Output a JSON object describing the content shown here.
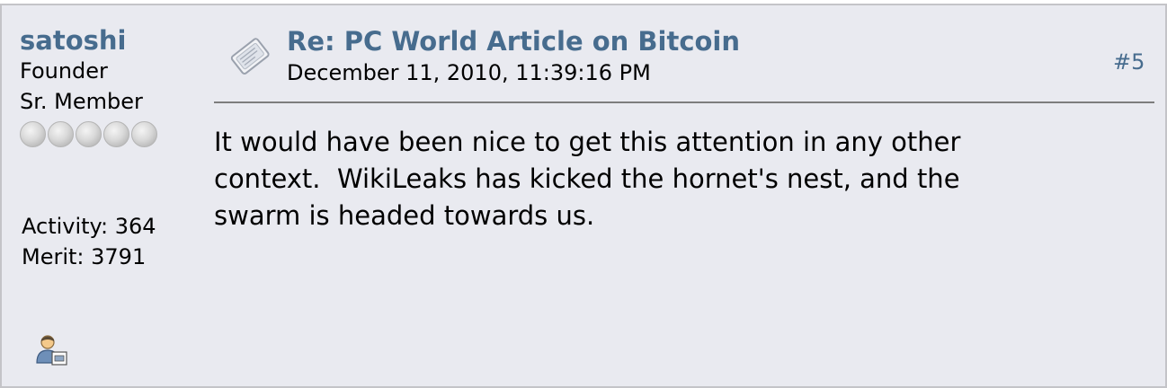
{
  "poster": {
    "name": "satoshi",
    "title": "Founder",
    "rank": "Sr. Member",
    "stars_filled": 0,
    "stars_total": 5,
    "activity": "Activity: 364",
    "merit": "Merit: 3791"
  },
  "post": {
    "subject": "Re: PC World Article on Bitcoin",
    "date": "December 11, 2010, 11:39:16 PM",
    "number": "#5",
    "body": "It would have been nice to get this attention in any other\ncontext.  WikiLeaks has kicked the hornet's nest, and the\nswarm is headed towards us."
  },
  "icons": {
    "post": "post-message-icon",
    "profile": "view-profile-icon",
    "rank_star": "rank-star-icon"
  },
  "colors": {
    "background": "#e9eaf0",
    "link": "#476c8e",
    "text": "#000000",
    "divider": "#7d7d7d"
  }
}
